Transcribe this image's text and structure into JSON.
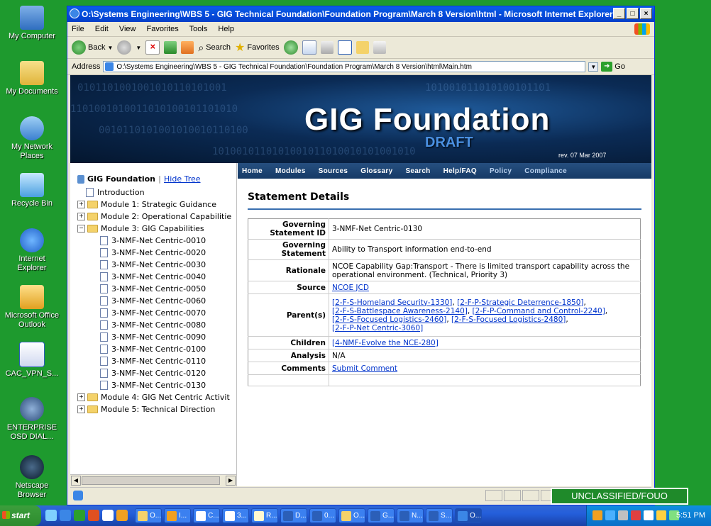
{
  "desktop": {
    "icons": [
      {
        "label": "My Computer"
      },
      {
        "label": "My Documents"
      },
      {
        "label": "My Network Places"
      },
      {
        "label": "Recycle Bin"
      },
      {
        "label": "Internet Explorer"
      },
      {
        "label": "Microsoft Office Outlook"
      },
      {
        "label": "CAC_VPN_S..."
      },
      {
        "label": "ENTERPRISE OSD DIAL..."
      },
      {
        "label": "Netscape Browser"
      }
    ]
  },
  "window": {
    "title": "O:\\Systems Engineering\\WBS 5 - GIG Technical Foundation\\Foundation Program\\March 8 Version\\html - Microsoft Internet Explorer",
    "menu": [
      "File",
      "Edit",
      "View",
      "Favorites",
      "Tools",
      "Help"
    ],
    "toolbar": {
      "back": "Back",
      "search": "Search",
      "favorites": "Favorites"
    },
    "address": {
      "label": "Address",
      "value": "O:\\Systems Engineering\\WBS 5 - GIG Technical Foundation\\Foundation Program\\March 8 Version\\html\\Main.htm",
      "go": "Go"
    }
  },
  "banner": {
    "title": "GIG Foundation",
    "draft": "DRAFT",
    "rev": "rev. 07 Mar 2007"
  },
  "nav": {
    "items": [
      "Home",
      "Modules",
      "Sources",
      "Glossary",
      "Search",
      "Help/FAQ",
      "Policy",
      "Compliance"
    ]
  },
  "tree": {
    "title": "GIG Foundation",
    "hide": "Hide Tree",
    "items": [
      {
        "label": "Introduction"
      },
      {
        "label": "Module 1: Strategic Guidance"
      },
      {
        "label": "Module 2: Operational Capabilitie"
      },
      {
        "label": "Module 3: GIG Capabilities"
      },
      {
        "label": "3-NMF-Net Centric-0010"
      },
      {
        "label": "3-NMF-Net Centric-0020"
      },
      {
        "label": "3-NMF-Net Centric-0030"
      },
      {
        "label": "3-NMF-Net Centric-0040"
      },
      {
        "label": "3-NMF-Net Centric-0050"
      },
      {
        "label": "3-NMF-Net Centric-0060"
      },
      {
        "label": "3-NMF-Net Centric-0070"
      },
      {
        "label": "3-NMF-Net Centric-0080"
      },
      {
        "label": "3-NMF-Net Centric-0090"
      },
      {
        "label": "3-NMF-Net Centric-0100"
      },
      {
        "label": "3-NMF-Net Centric-0110"
      },
      {
        "label": "3-NMF-Net Centric-0120"
      },
      {
        "label": "3-NMF-Net Centric-0130"
      },
      {
        "label": "Module 4: GIG Net Centric Activit"
      },
      {
        "label": "Module 5: Technical Direction"
      }
    ]
  },
  "main": {
    "heading": "Statement Details",
    "rows": {
      "id_key": "Governing Statement ID",
      "id_val": "3-NMF-Net Centric-0130",
      "stmt_key": "Governing Statement",
      "stmt_val": "Ability to Transport information end-to-end",
      "rationale_key": "Rationale",
      "rationale_val": "NCOE Capability Gap:Transport - There is limited transport capability across the operational environment. (Technical, Priority 3)",
      "source_key": "Source",
      "source_val": "NCOE JCD",
      "parents_key": "Parent(s)",
      "parents": [
        "[2-F-S-Homeland Security-1330]",
        "[2-F-P-Strategic Deterrence-1850]",
        "[2-F-S-Battlespace Awareness-2140]",
        "[2-F-P-Command and Control-2240]",
        "[2-F-S-Focused Logistics-2460]",
        "[2-F-S-Focused Logistics-2480]",
        "[2-F-P-Net Centric-3060]"
      ],
      "children_key": "Children",
      "children_val": "[4-NMF-Evolve the NCE-280]",
      "analysis_key": "Analysis",
      "analysis_val": "N/A",
      "comments_key": "Comments",
      "comments_val": "Submit Comment"
    }
  },
  "classification": "UNCLASSIFIED/FOUO",
  "taskbar": {
    "start": "start",
    "tasks": [
      "O...",
      "I...",
      "C...",
      "3...",
      "R...",
      "D...",
      "0...",
      "O...",
      "G...",
      "N...",
      "S...",
      "O..."
    ],
    "clock": "5:51 PM"
  }
}
